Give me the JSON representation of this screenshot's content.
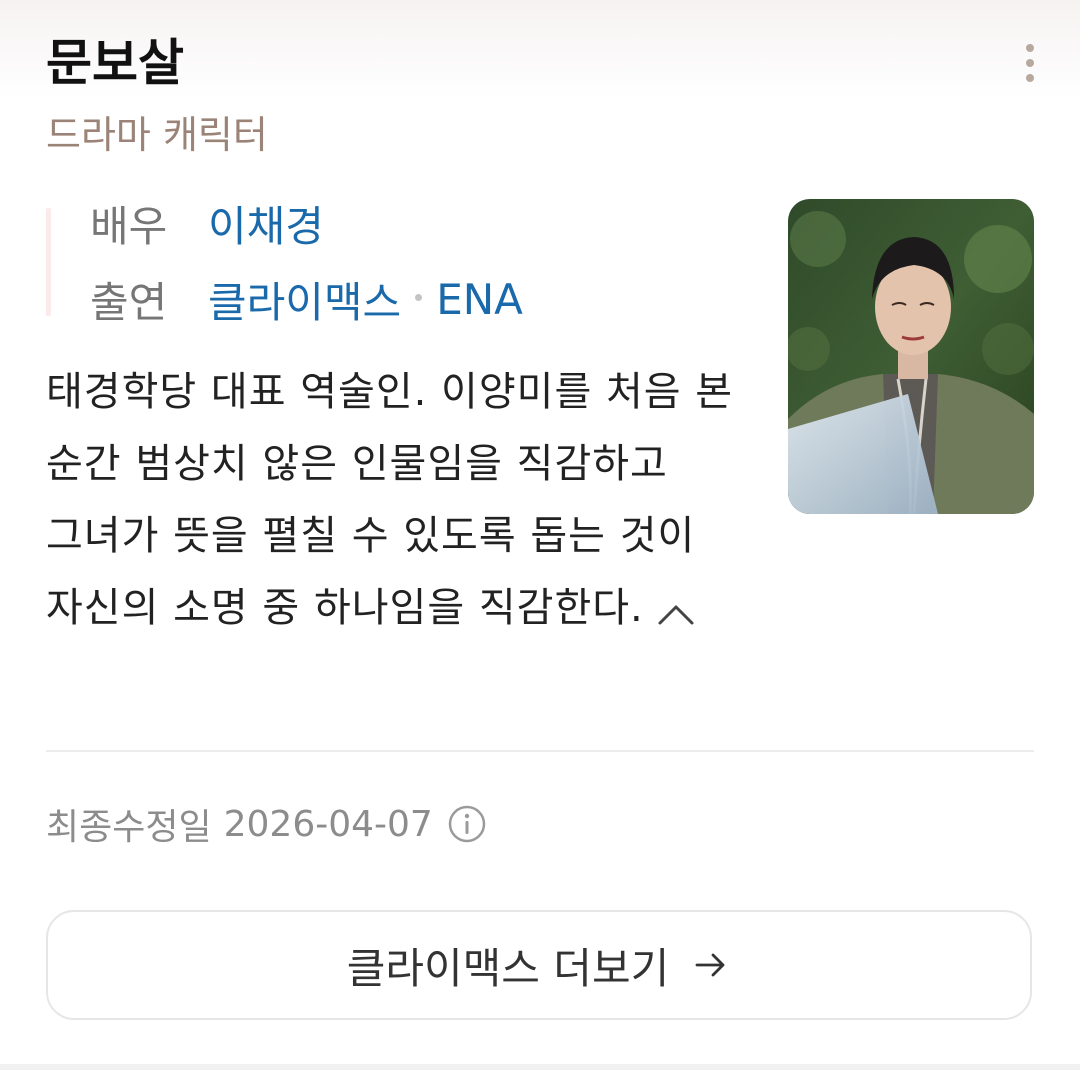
{
  "card": {
    "title": "문보살",
    "subtitle": "드라마 캐릭터",
    "info": [
      {
        "label": "배우",
        "values": [
          "이채경"
        ]
      },
      {
        "label": "출연",
        "values": [
          "클라이맥스",
          "ENA"
        ]
      }
    ],
    "description": "태경학당 대표 역술인. 이양미를 처음 본 순간 범상치 않은 인물임을 직감하고 그녀가 뜻을 펼칠 수 있도록 돕는 것이 자신의 소명 중 하나임을 직감한다.",
    "modified_label": "최종수정일",
    "modified_date": "2026-04-07",
    "more_button_label": "클라이맥스 더보기"
  },
  "icons": {
    "menu": "more-vertical-icon",
    "collapse": "chevron-up-icon",
    "info": "info-circle-icon",
    "arrow": "arrow-right-icon"
  },
  "colors": {
    "link": "#1a6aab",
    "subtitle": "#9b8477",
    "muted": "#8c8c8c"
  }
}
